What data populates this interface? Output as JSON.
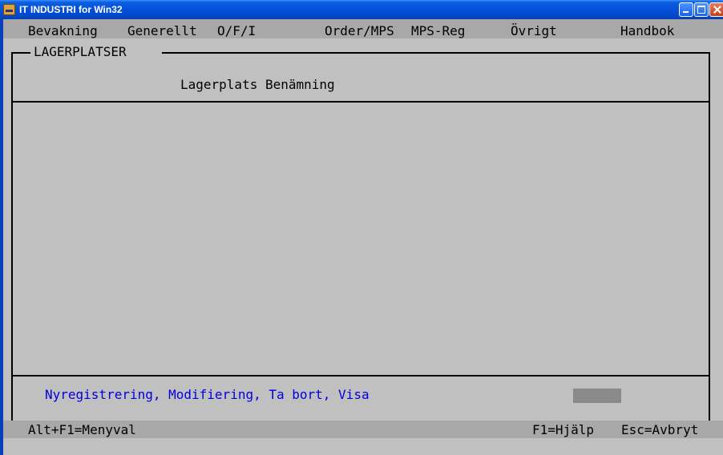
{
  "window": {
    "title": "IT INDUSTRI for Win32"
  },
  "menu": {
    "bevakning": "Bevakning",
    "generellt": "Generellt",
    "ofi": "O/F/I",
    "order_mps": "Order/MPS",
    "mps_reg": "MPS-Reg",
    "ovrigt": "Övrigt",
    "handbok": "Handbok"
  },
  "form": {
    "title": "LAGERPLATSER",
    "header": "Lagerplats Benämning",
    "options": "Nyregistrering, Modifiering, Ta bort, Visa"
  },
  "status": {
    "left": "Alt+F1=Menyval",
    "help": "F1=Hjälp",
    "abort": "Esc=Avbryt"
  }
}
